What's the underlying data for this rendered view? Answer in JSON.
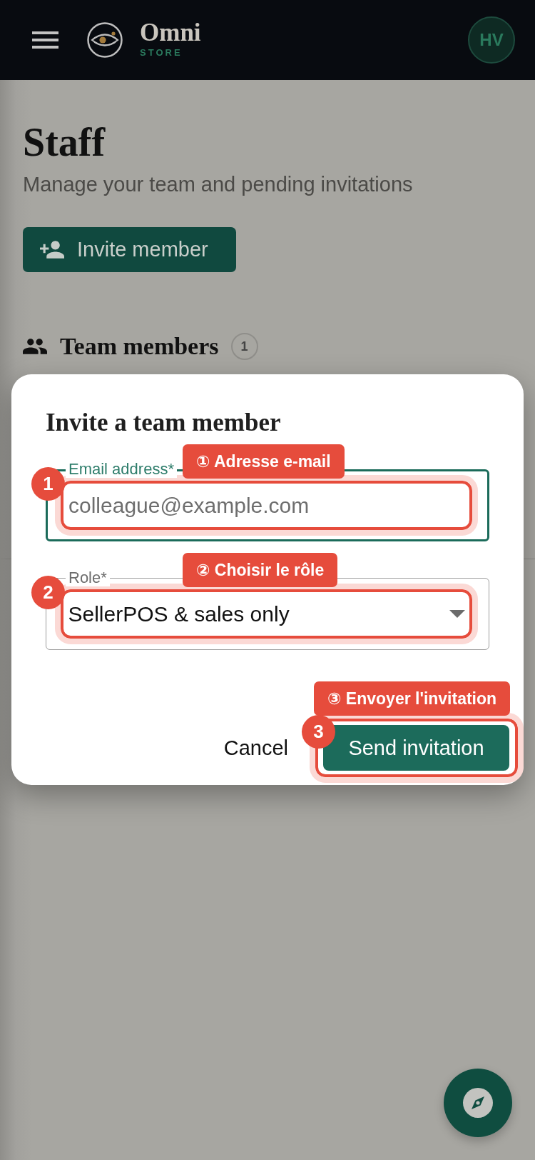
{
  "top_bar": {
    "brand": {
      "name": "Omni",
      "tagline": "STORE"
    },
    "avatar": {
      "initials": "HV"
    }
  },
  "page": {
    "title": "Staff",
    "subtitle": "Manage your team and pending invitations",
    "invite_button": {
      "label": "Invite member"
    },
    "section": {
      "title": "Team members",
      "count": "1"
    }
  },
  "dialog": {
    "title": "Invite a team member",
    "fields": [
      {
        "kind": "text",
        "label": "Email address*",
        "placeholder": "colleague@example.com",
        "focused": true,
        "annotation": {
          "number": "1",
          "callout": "① Adresse e-mail"
        }
      },
      {
        "kind": "select",
        "label": "Role*",
        "value": "SellerPOS & sales only",
        "focused": false,
        "annotation": {
          "number": "2",
          "callout": "② Choisir le rôle"
        }
      }
    ],
    "buttons": [
      {
        "kind": "text",
        "label": "Cancel"
      },
      {
        "kind": "primary",
        "label": "Send invitation",
        "annotation": {
          "number": "3",
          "callout": "③ Envoyer l'invitation"
        }
      }
    ]
  }
}
